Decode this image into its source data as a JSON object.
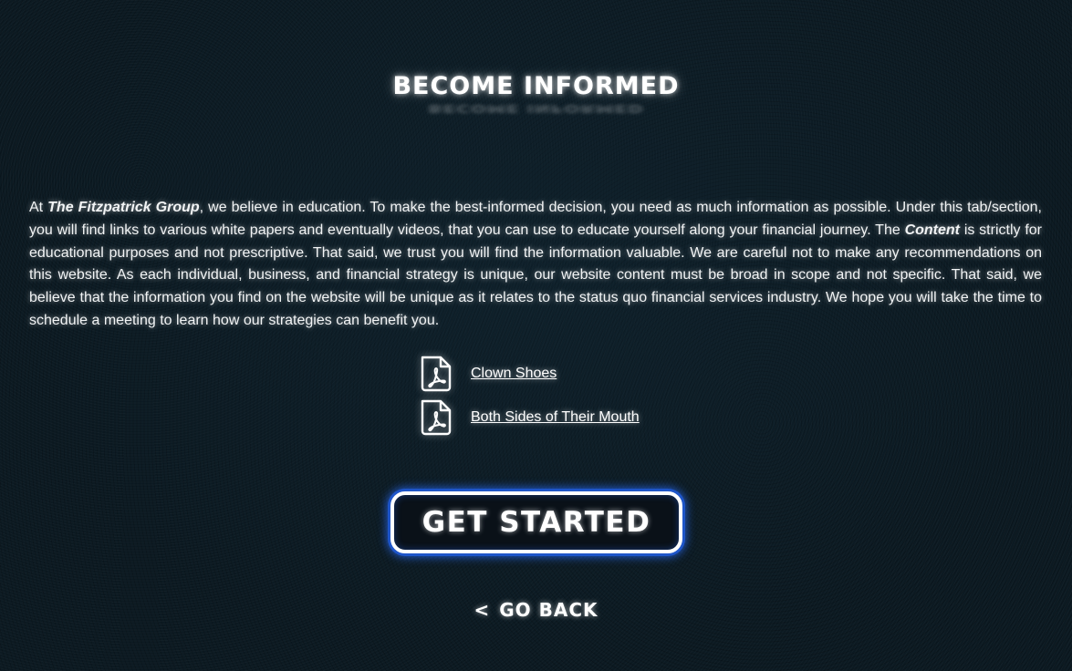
{
  "heading": {
    "title": "BECOME INFORMED"
  },
  "intro": {
    "p1": "At ",
    "firm_name": "The Fitzpatrick Group",
    "p2": ", we believe in education. To make the best-informed decision, you need as much information as possible. Under this tab/section, you will find links to various white papers and eventually videos, that you can use to educate yourself along your financial journey. The ",
    "content_word": "Content",
    "p3": " is strictly for educational purposes and not prescriptive. That said, we trust you will find the information valuable. We are careful not to make any recommendations on this website. As each individual, business, and financial strategy is unique, our website content must be broad in scope and not specific. That said, we believe that the information you find on the website will be unique as it relates to the status quo financial services industry. We hope you will take the time to schedule a meeting to learn how our strategies can benefit you."
  },
  "documents": [
    {
      "label": "Clown Shoes",
      "icon": "pdf-file-icon"
    },
    {
      "label": "Both Sides of Their Mouth",
      "icon": "pdf-file-icon"
    }
  ],
  "cta": {
    "label": "GET STARTED",
    "border_color": "#ffffff",
    "glow_color": "#1e55c9"
  },
  "back": {
    "chevron": "<",
    "label": "GO BACK"
  },
  "colors": {
    "background": "#0c1a22",
    "text": "#ffffff"
  }
}
